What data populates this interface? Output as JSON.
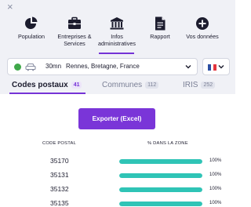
{
  "nav": {
    "items": [
      {
        "label_lines": [
          "Population"
        ],
        "icon": "pie-chart-icon"
      },
      {
        "label_lines": [
          "Entreprises &",
          "Services"
        ],
        "icon": "briefcase-icon"
      },
      {
        "label_lines": [
          "Infos",
          "administratives"
        ],
        "icon": "institution-icon",
        "active": true
      },
      {
        "label_lines": [
          "Rapport"
        ],
        "icon": "document-icon"
      },
      {
        "label_lines": [
          "Vos données"
        ],
        "icon": "plus-circle-icon"
      }
    ]
  },
  "close_symbol": "×",
  "location": {
    "status_color": "#3fa84a",
    "duration": "30mn",
    "place": "Rennes, Bretagne, France"
  },
  "language": {
    "flag": "france-flag"
  },
  "tabs": [
    {
      "label": "Codes postaux",
      "count": "41",
      "active": true
    },
    {
      "label": "Communes",
      "count": "112"
    },
    {
      "label": "IRIS",
      "count": "252"
    }
  ],
  "export_label": "Exporter (Excel)",
  "table": {
    "headers": {
      "code": "CODE POSTAL",
      "pct": "% DANS LA ZONE"
    },
    "rows": [
      {
        "code": "35170",
        "pct_label": "100%",
        "fraction": 1.0
      },
      {
        "code": "35131",
        "pct_label": "100%",
        "fraction": 1.0
      },
      {
        "code": "35132",
        "pct_label": "100%",
        "fraction": 1.0
      },
      {
        "code": "35135",
        "pct_label": "100%",
        "fraction": 1.0
      }
    ]
  },
  "colors": {
    "accent": "#7533d6",
    "bar": "#2fc4b6"
  }
}
